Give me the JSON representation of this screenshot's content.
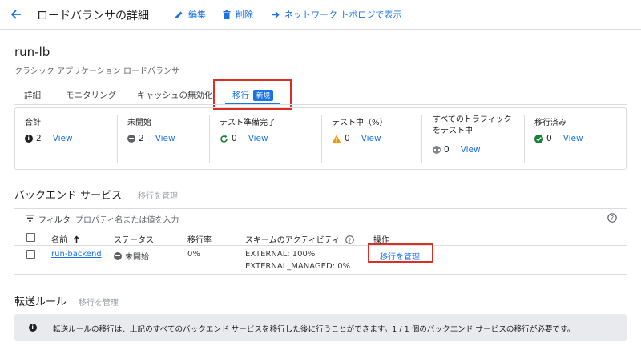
{
  "header": {
    "title": "ロードバランサの詳細",
    "edit_label": "編集",
    "delete_label": "削除",
    "topology_label": "ネットワーク トポロジで表示"
  },
  "lb": {
    "name": "run-lb",
    "subtitle": "クラシック アプリケーション ロードバランサ"
  },
  "tabs": [
    {
      "label": "詳細"
    },
    {
      "label": "モニタリング"
    },
    {
      "label": "キャッシュの無効化"
    },
    {
      "label": "移行",
      "badge": "新規"
    }
  ],
  "summary": [
    {
      "label": "合計",
      "count": "2",
      "link": "View"
    },
    {
      "label": "未開始",
      "count": "2",
      "link": "View"
    },
    {
      "label": "テスト準備完了",
      "count": "0",
      "link": "View"
    },
    {
      "label": "テスト中（%）",
      "count": "0",
      "link": "View"
    },
    {
      "label_line1": "すべてのトラフィック",
      "label_line2": "をテスト中",
      "count": "0",
      "link": "View"
    },
    {
      "label": "移行済み",
      "count": "0",
      "link": "View"
    }
  ],
  "backend": {
    "title": "バックエンド サービス",
    "manage_link": "移行を管理",
    "filter_label": "フィルタ",
    "filter_placeholder": "プロパティ名または値を入力",
    "columns": {
      "name": "名前",
      "status": "ステータス",
      "rate": "移行率",
      "scheme": "スキームのアクティビティ",
      "action": "操作"
    },
    "rows": [
      {
        "name": "run-backend",
        "status": "未開始",
        "rate": "0%",
        "scheme_line1": "EXTERNAL: 100%",
        "scheme_line2": "EXTERNAL_MANAGED: 0%",
        "action": "移行を管理"
      }
    ]
  },
  "forwarding": {
    "title": "転送ルール",
    "manage_link": "移行を管理",
    "info": "転送ルールの移行は、上記のすべてのバックエンド サービスを移行した後に行うことができます。1 / 1 個のバックエンド サービスの移行が必要です。"
  },
  "colors": {
    "accent": "#1a73e8",
    "highlight": "#d93025",
    "warning": "#f29900",
    "success": "#188038"
  }
}
